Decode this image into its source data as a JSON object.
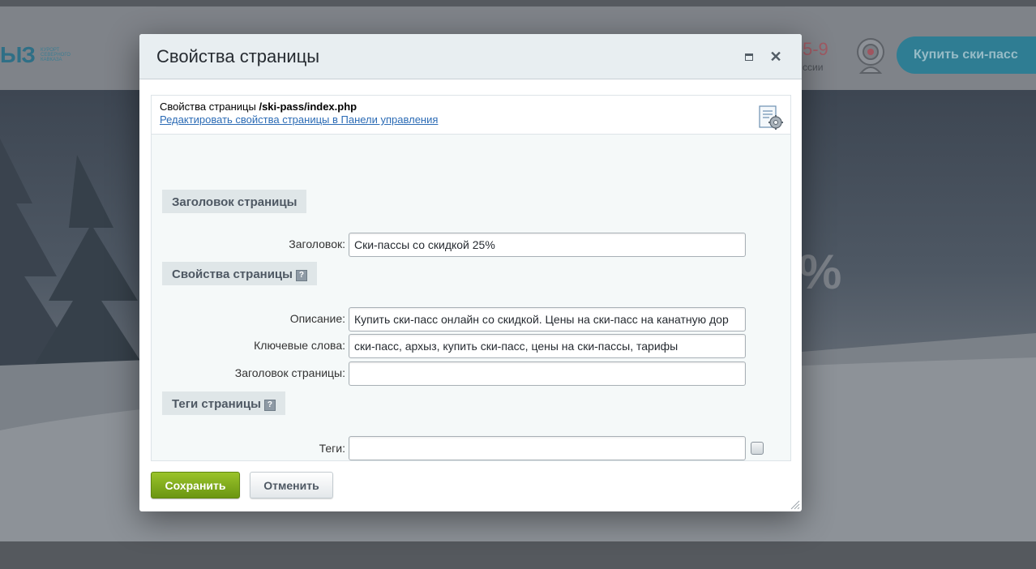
{
  "background": {
    "logo": "ЫЗ",
    "logo_sub": "КУРОРТ СЕВЕРНОГО КАВКАЗА",
    "phone": "5-9",
    "phone_sub": "ссии",
    "buy_button": "Купить ски-пасс",
    "hero_percent": "%"
  },
  "dialog": {
    "title": "Свойства страницы",
    "info": {
      "prefix": "Свойства страницы ",
      "path": "/ski-pass/index.php",
      "link": "Редактировать свойства страницы в Панели управления"
    },
    "sections": {
      "title_section": "Заголовок страницы",
      "props_section": "Свойства страницы",
      "tags_section": "Теги страницы"
    },
    "fields": {
      "title_label": "Заголовок:",
      "title_value": "Ски-пассы со скидкой 25%",
      "description_label": "Описание:",
      "description_value": "Купить ски-пасс онлайн со скидкой. Цены на ски-пасс на канатную дор",
      "keywords_label": "Ключевые слова:",
      "keywords_value": "ски-пасс, архыз, купить ски-пасс, цены на ски-пассы, тарифы",
      "page_title_label": "Заголовок страницы:",
      "page_title_value": "",
      "tags_label": "Теги:",
      "tags_value": ""
    },
    "buttons": {
      "save": "Сохранить",
      "cancel": "Отменить"
    },
    "help_glyph": "?"
  },
  "colors": {
    "save_green": "#7fad1a",
    "link_blue": "#2b6bb5",
    "section_bg": "#dfe6e8"
  }
}
